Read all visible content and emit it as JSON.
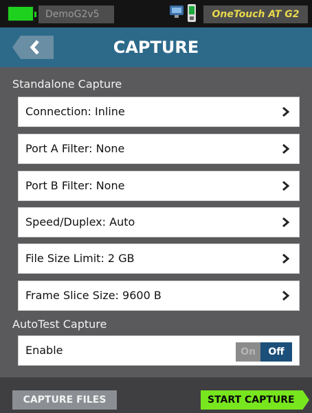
{
  "status_bar": {
    "device_name": "DemoG2v5",
    "product_name": "OneTouch AT G2",
    "icons": [
      "battery-icon",
      "network-icon",
      "phone-icon"
    ]
  },
  "header": {
    "title": "CAPTURE",
    "back_icon": "chevron-left-icon"
  },
  "standalone": {
    "section_label": "Standalone Capture",
    "rows": [
      {
        "label": "Connection: Inline"
      },
      {
        "label": "Port A Filter: None"
      },
      {
        "label": "Port B Filter: None"
      },
      {
        "label": "Speed/Duplex: Auto"
      },
      {
        "label": "File Size Limit: 2 GB"
      },
      {
        "label": "Frame Slice Size: 9600 B"
      }
    ]
  },
  "autotest": {
    "section_label": "AutoTest Capture",
    "enable_label": "Enable",
    "toggle_on": "On",
    "toggle_off": "Off",
    "selected": "Off"
  },
  "footer": {
    "files_button": "CAPTURE FILES",
    "start_button": "START CAPTURE"
  },
  "colors": {
    "title_bar": "#2d6a8a",
    "background": "#5a5a5c",
    "start_button": "#78e61e",
    "toggle_off": "#1c4f7a",
    "product_name": "#e8d84c",
    "battery": "#1fd11f"
  }
}
